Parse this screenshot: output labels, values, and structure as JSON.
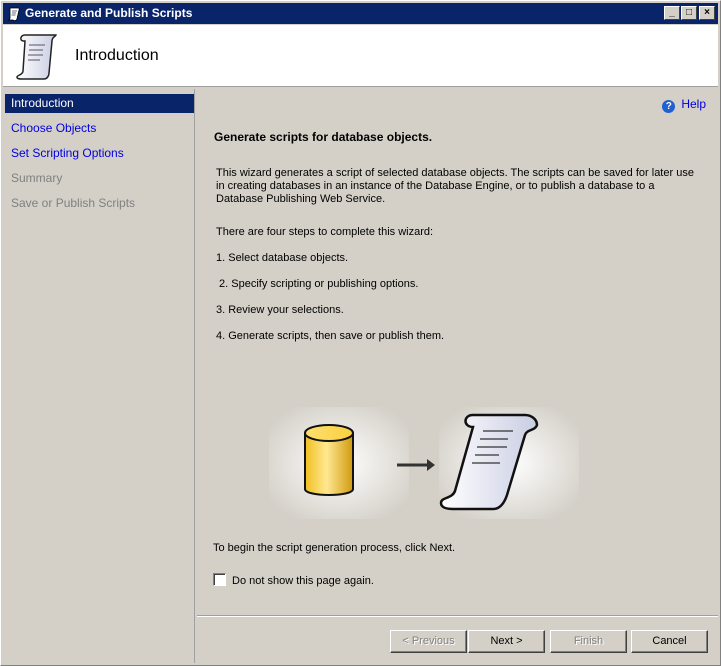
{
  "window": {
    "title": "Generate and Publish Scripts",
    "controls": [
      "_",
      "□",
      "×"
    ]
  },
  "header": {
    "page_title": "Introduction",
    "icon": "scroll-icon"
  },
  "sidebar": {
    "items": [
      {
        "label": "Introduction",
        "state": "active"
      },
      {
        "label": "Choose Objects",
        "state": "link"
      },
      {
        "label": "Set Scripting Options",
        "state": "link"
      },
      {
        "label": "Summary",
        "state": "disabled"
      },
      {
        "label": "Save or Publish Scripts",
        "state": "disabled"
      }
    ]
  },
  "main": {
    "help_label": "Help",
    "heading": "Generate scripts for database objects.",
    "description": "This wizard generates a script of selected database objects. The scripts can be saved for later use in creating databases in an instance of the Database Engine, or to publish a database to a Database Publishing Web Service.",
    "steps_intro": "There are four steps to complete this wizard:",
    "steps": [
      "1. Select database objects.",
      " 2. Specify scripting or publishing options.",
      "3. Review your selections.",
      "4. Generate scripts, then save or publish them."
    ],
    "begin_text": "To begin the script generation process, click Next.",
    "checkbox_label": "Do not show this page again.",
    "checkbox_checked": false
  },
  "buttons": {
    "previous": "< Previous",
    "next": "Next >",
    "finish": "Finish",
    "cancel": "Cancel"
  },
  "colors": {
    "titlebar": "#0a246a",
    "link": "#0000e0",
    "face": "#d4d0c8"
  }
}
